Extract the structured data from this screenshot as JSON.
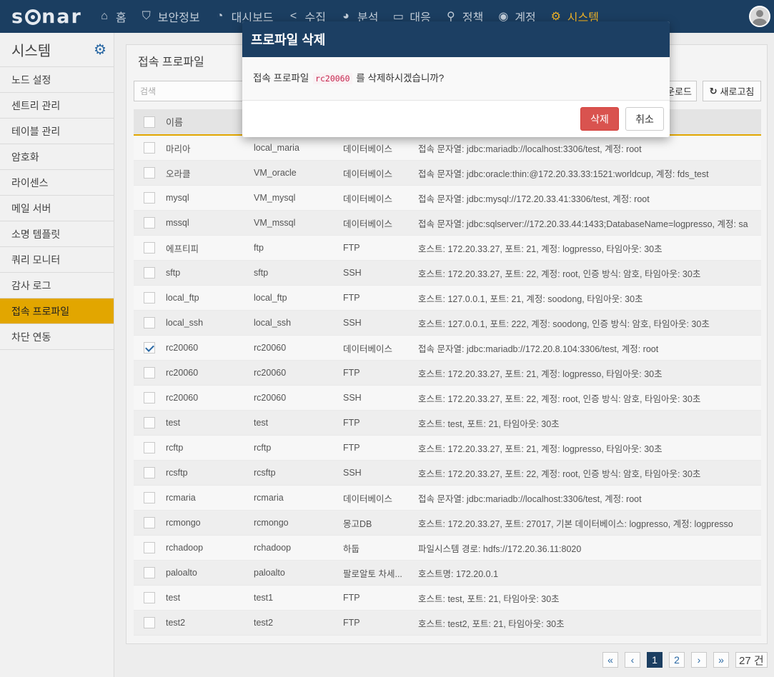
{
  "nav": {
    "brand": "sonar",
    "items": [
      {
        "label": "홈",
        "icon": "home-icon",
        "glyph": "⌂"
      },
      {
        "label": "보안정보",
        "icon": "shield-icon",
        "glyph": "⛉"
      },
      {
        "label": "대시보드",
        "icon": "dashboard-icon",
        "glyph": "◔"
      },
      {
        "label": "수집",
        "icon": "share-icon",
        "glyph": "<"
      },
      {
        "label": "분석",
        "icon": "pie-chart-icon",
        "glyph": "◕"
      },
      {
        "label": "대응",
        "icon": "laptop-icon",
        "glyph": "▭"
      },
      {
        "label": "정책",
        "icon": "search-icon",
        "glyph": "⚲"
      },
      {
        "label": "계정",
        "icon": "user-circle-icon",
        "glyph": "◉"
      },
      {
        "label": "시스템",
        "icon": "gear-icon",
        "glyph": "⚙",
        "active": true
      }
    ]
  },
  "sidebar": {
    "title": "시스템",
    "items": [
      {
        "label": "노드 설정"
      },
      {
        "label": "센트리 관리"
      },
      {
        "label": "테이블 관리"
      },
      {
        "label": "암호화"
      },
      {
        "label": "라이센스"
      },
      {
        "label": "메일 서버"
      },
      {
        "label": "소명 템플릿"
      },
      {
        "label": "쿼리 모니터"
      },
      {
        "label": "감사 로그"
      },
      {
        "label": "접속 프로파일",
        "active": true
      },
      {
        "label": "차단 연동"
      }
    ]
  },
  "main": {
    "title": "접속 프로파일",
    "search_placeholder": "검색",
    "download_label": "운로드",
    "refresh_label": "새로고침",
    "column_name": "이름"
  },
  "table": {
    "rows": [
      {
        "name": "마리아",
        "id": "local_maria",
        "type": "데이터베이스",
        "desc": "접속 문자열: jdbc:mariadb://localhost:3306/test, 계정: root",
        "checked": false
      },
      {
        "name": "오라클",
        "id": "VM_oracle",
        "type": "데이터베이스",
        "desc": "접속 문자열: jdbc:oracle:thin:@172.20.33.33:1521:worldcup, 계정: fds_test",
        "checked": false
      },
      {
        "name": "mysql",
        "id": "VM_mysql",
        "type": "데이터베이스",
        "desc": "접속 문자열: jdbc:mysql://172.20.33.41:3306/test, 계정: root",
        "checked": false
      },
      {
        "name": "mssql",
        "id": "VM_mssql",
        "type": "데이터베이스",
        "desc": "접속 문자열: jdbc:sqlserver://172.20.33.44:1433;DatabaseName=logpresso, 계정: sa",
        "checked": false
      },
      {
        "name": "에프티피",
        "id": "ftp",
        "type": "FTP",
        "desc": "호스트: 172.20.33.27, 포트: 21, 계정: logpresso, 타임아웃: 30초",
        "checked": false
      },
      {
        "name": "sftp",
        "id": "sftp",
        "type": "SSH",
        "desc": "호스트: 172.20.33.27, 포트: 22, 계정: root, 인증 방식: 암호, 타임아웃: 30초",
        "checked": false
      },
      {
        "name": "local_ftp",
        "id": "local_ftp",
        "type": "FTP",
        "desc": "호스트: 127.0.0.1, 포트: 21, 계정: soodong, 타임아웃: 30초",
        "checked": false
      },
      {
        "name": "local_ssh",
        "id": "local_ssh",
        "type": "SSH",
        "desc": "호스트: 127.0.0.1, 포트: 222, 계정: soodong, 인증 방식: 암호, 타임아웃: 30초",
        "checked": false
      },
      {
        "name": "rc20060",
        "id": "rc20060",
        "type": "데이터베이스",
        "desc": "접속 문자열: jdbc:mariadb://172.20.8.104:3306/test, 계정: root",
        "checked": true
      },
      {
        "name": "rc20060",
        "id": "rc20060",
        "type": "FTP",
        "desc": "호스트: 172.20.33.27, 포트: 21, 계정: logpresso, 타임아웃: 30초",
        "checked": false
      },
      {
        "name": "rc20060",
        "id": "rc20060",
        "type": "SSH",
        "desc": "호스트: 172.20.33.27, 포트: 22, 계정: root, 인증 방식: 암호, 타임아웃: 30초",
        "checked": false
      },
      {
        "name": "test",
        "id": "test",
        "type": "FTP",
        "desc": "호스트: test, 포트: 21, 타임아웃: 30초",
        "checked": false
      },
      {
        "name": "rcftp",
        "id": "rcftp",
        "type": "FTP",
        "desc": "호스트: 172.20.33.27, 포트: 21, 계정: logpresso, 타임아웃: 30초",
        "checked": false
      },
      {
        "name": "rcsftp",
        "id": "rcsftp",
        "type": "SSH",
        "desc": "호스트: 172.20.33.27, 포트: 22, 계정: root, 인증 방식: 암호, 타임아웃: 30초",
        "checked": false
      },
      {
        "name": "rcmaria",
        "id": "rcmaria",
        "type": "데이터베이스",
        "desc": "접속 문자열: jdbc:mariadb://localhost:3306/test, 계정: root",
        "checked": false
      },
      {
        "name": "rcmongo",
        "id": "rcmongo",
        "type": "몽고DB",
        "desc": "호스트: 172.20.33.27, 포트: 27017, 기본 데이터베이스: logpresso, 계정: logpresso",
        "checked": false
      },
      {
        "name": "rchadoop",
        "id": "rchadoop",
        "type": "하둡",
        "desc": "파일시스템 경로: hdfs://172.20.36.11:8020",
        "checked": false
      },
      {
        "name": "paloalto",
        "id": "paloalto",
        "type": "팔로알토 차세...",
        "desc": "호스트명: 172.20.0.1",
        "checked": false
      },
      {
        "name": "test",
        "id": "test1",
        "type": "FTP",
        "desc": "호스트: test, 포트: 21, 타임아웃: 30초",
        "checked": false
      },
      {
        "name": "test2",
        "id": "test2",
        "type": "FTP",
        "desc": "호스트: test2, 포트: 21, 타임아웃: 30초",
        "checked": false
      }
    ]
  },
  "pagination": {
    "first": "«",
    "prev": "‹",
    "pages": [
      "1",
      "2"
    ],
    "current": "1",
    "next": "›",
    "last": "»",
    "total": "27 건"
  },
  "modal": {
    "title": "프로파일 삭제",
    "message_prefix": "접속 프로파일",
    "target": "rc20060",
    "message_suffix": "를 삭제하시겠습니까?",
    "delete_label": "삭제",
    "cancel_label": "취소"
  }
}
